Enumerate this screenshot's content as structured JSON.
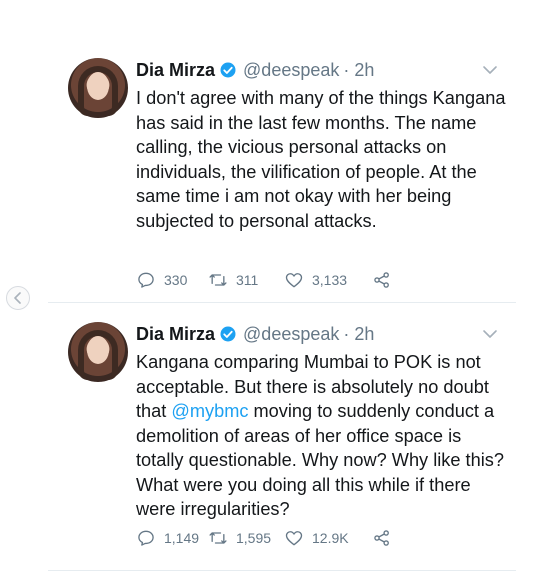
{
  "tweets": [
    {
      "name": "Dia Mirza",
      "handle": "@deespeak",
      "time": "· 2h",
      "text_parts": [
        "I don't agree with many of the things Kangana has said in the last few months. The name calling, the vicious personal attacks on individuals, the vilification of people. At the same time i am not okay with her being subjected to personal attacks."
      ],
      "replies": "330",
      "retweets": "311",
      "likes": "3,133"
    },
    {
      "name": "Dia Mirza",
      "handle": "@deespeak",
      "time": "· 2h",
      "text_before": "Kangana comparing Mumbai to POK is not acceptable. But there is absolutely no doubt that ",
      "mention": "@mybmc",
      "text_after": " moving to suddenly conduct a demolition of areas of her office space is totally questionable. Why now? Why like this? What were you doing all this while if there were irregularities?",
      "replies": "1,149",
      "retweets": "1,595",
      "likes": "12.9K"
    }
  ],
  "colors": {
    "verified": "#1da1f2",
    "mention": "#1da1f2",
    "muted": "#657786",
    "text": "#14171a"
  },
  "icons": [
    "verified-badge-icon",
    "chevron-down-icon",
    "reply-icon",
    "retweet-icon",
    "like-icon",
    "share-icon",
    "back-arrow-icon"
  ]
}
